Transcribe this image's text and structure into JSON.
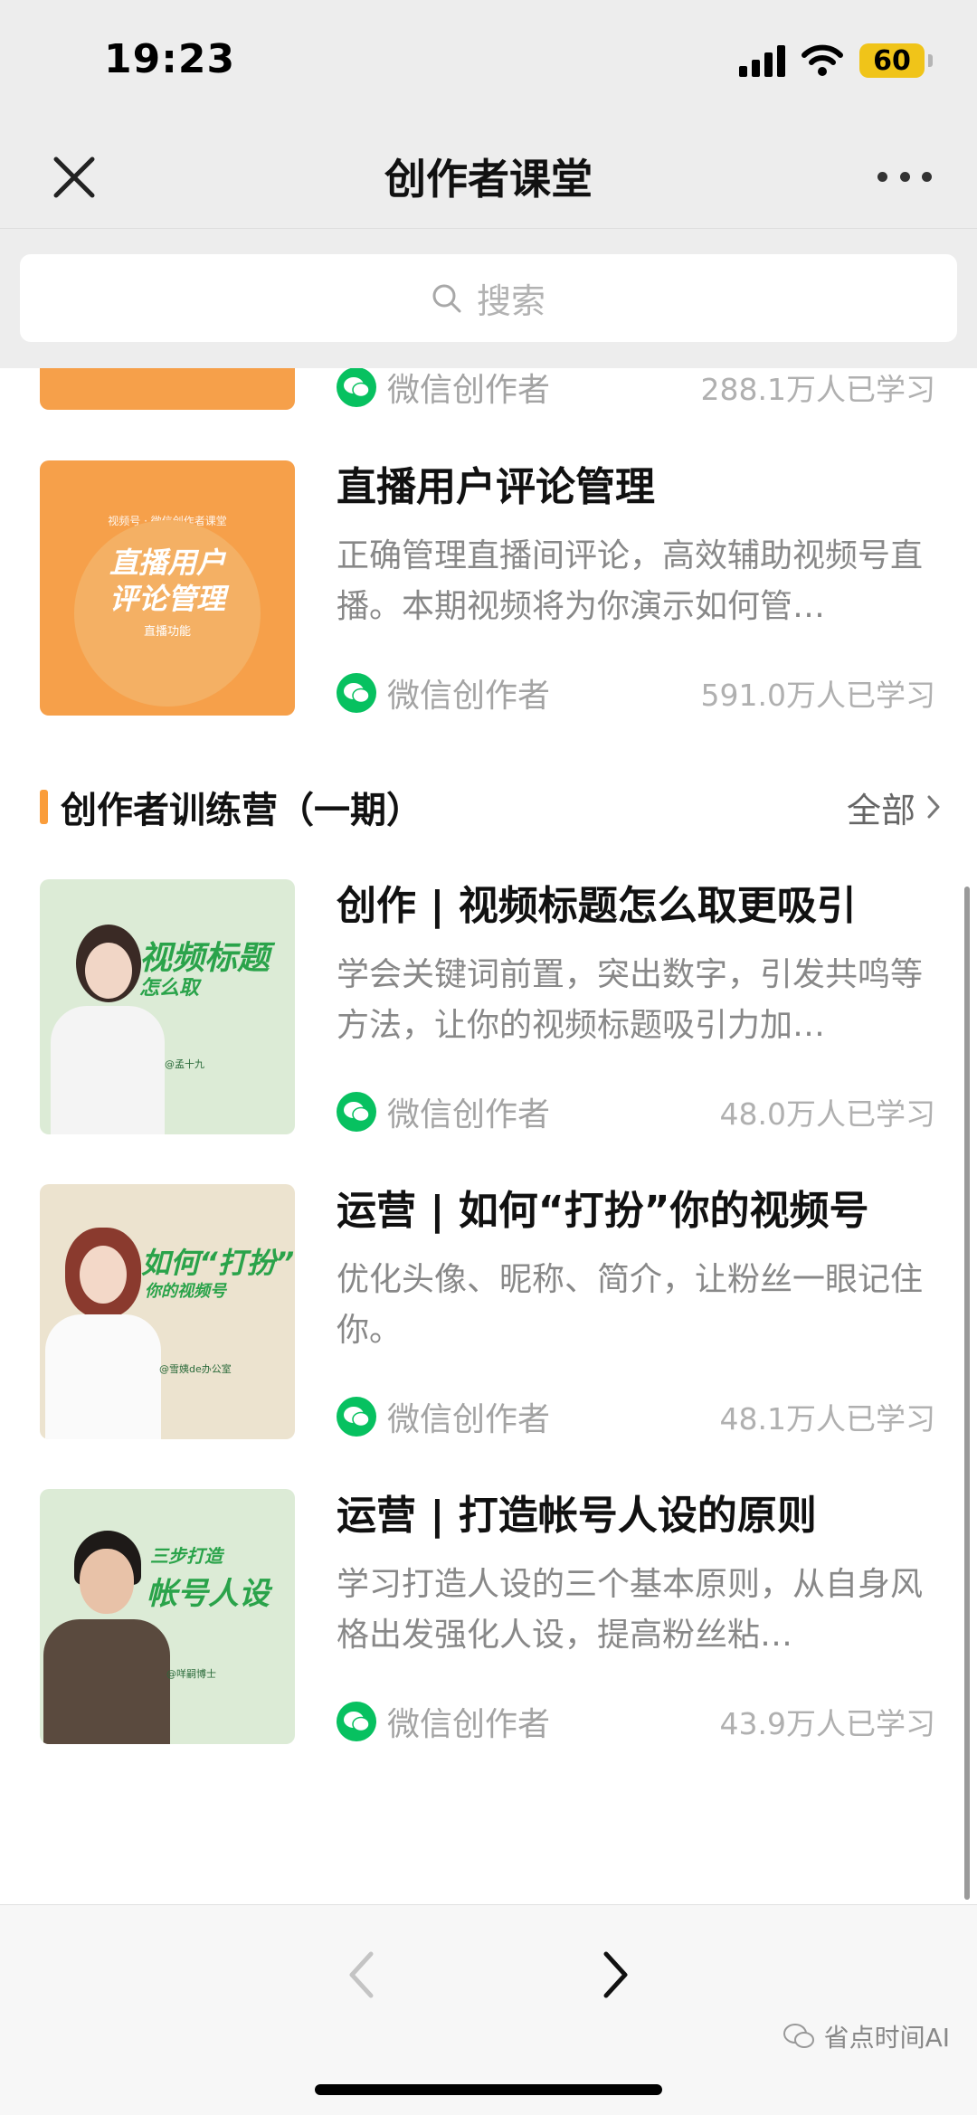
{
  "status": {
    "time": "19:23",
    "battery": "60"
  },
  "nav": {
    "title": "创作者课堂"
  },
  "search": {
    "placeholder": "搜索"
  },
  "partial_item": {
    "source": "微信创作者",
    "learners": "288.1万人已学习"
  },
  "featured_item": {
    "title": "直播用户评论管理",
    "desc": "正确管理直播间评论，高效辅助视频号直播。本期视频将为你演示如何管…",
    "source": "微信创作者",
    "learners": "591.0万人已学习",
    "thumb": {
      "brand": "视频号 · 微信创作者课堂",
      "line1": "直播用户",
      "line2": "评论管理",
      "tag": "直播功能"
    }
  },
  "section": {
    "title": "创作者训练营（一期）",
    "all_label": "全部"
  },
  "courses": [
    {
      "title": "创作 | 视频标题怎么取更吸引",
      "desc": "学会关键词前置，突出数字，引发共鸣等方法，让你的视频标题吸引力加…",
      "source": "微信创作者",
      "learners": "48.0万人已学习",
      "thumb": {
        "line1": "视频标题",
        "line2": "怎么取",
        "tag": "@孟十九"
      }
    },
    {
      "title": "运营 | 如何“打扮”你的视频号",
      "desc": "优化头像、昵称、简介，让粉丝一眼记住你。",
      "source": "微信创作者",
      "learners": "48.1万人已学习",
      "thumb": {
        "line1": "如何“打扮”",
        "line2": "你的视频号",
        "tag": "@雪姨de办公室"
      }
    },
    {
      "title": "运营 | 打造帐号人设的原则",
      "desc": "学习打造人设的三个基本原则，从自身风格出发强化人设，提高粉丝粘…",
      "source": "微信创作者",
      "learners": "43.9万人已学习",
      "thumb": {
        "line1": "三步打造",
        "line2": "帐号人设",
        "tag": "@咩嗣博士"
      }
    }
  ],
  "watermark": "省点时间AI",
  "colors": {
    "accent_orange": "#fa9d3b",
    "wechat_green": "#07c160",
    "thumb_green": "#dcebd6",
    "thumb_beige": "#ece3cf"
  },
  "icons": [
    "close-icon",
    "more-icon",
    "search-icon",
    "wechat-icon",
    "chevron-right-icon",
    "back-arrow-icon",
    "forward-arrow-icon"
  ]
}
